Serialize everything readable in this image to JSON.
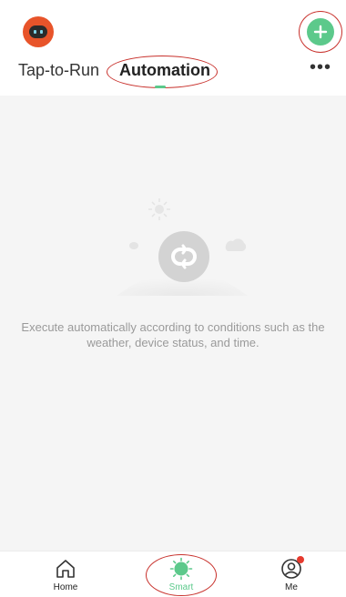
{
  "header": {
    "tabs": [
      {
        "label": "Tap-to-Run"
      },
      {
        "label": "Automation"
      }
    ],
    "more_label": "•••"
  },
  "empty_state": {
    "message": "Execute automatically according to conditions such as the weather, device status, and time."
  },
  "bottom_nav": [
    {
      "label": "Home",
      "icon": "home-icon"
    },
    {
      "label": "Smart",
      "icon": "smart-sun-icon",
      "active": true
    },
    {
      "label": "Me",
      "icon": "profile-icon",
      "badge": true
    }
  ],
  "colors": {
    "accent": "#5cc98b",
    "annotation": "#c8312c",
    "badge": "#e63a2e"
  }
}
